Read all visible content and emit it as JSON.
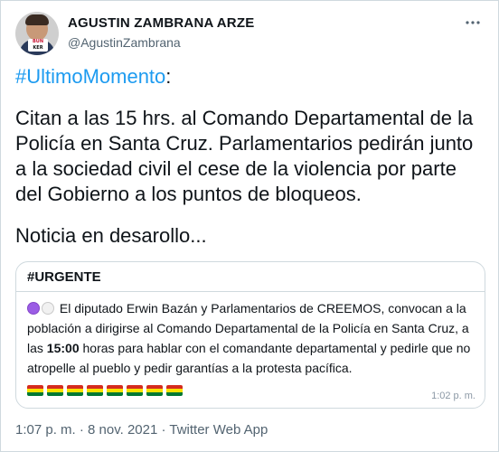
{
  "author": {
    "display_name": "AGUSTIN ZAMBRANA ARZE",
    "handle": "@AgustinZambrana",
    "avatar_logo_line1": "BUN",
    "avatar_logo_line2": "KER"
  },
  "more_icon": "more-horizontal-icon",
  "tweet": {
    "hashtag": "#UltimoMomento",
    "hashtag_suffix": ":",
    "paragraph": "Citan a las 15 hrs. al Comando Departamental de la Policía en Santa Cruz. Parlamentarios pedirán junto a la sociedad civil el cese de la violencia por parte del Gobierno a los puntos de bloqueos.",
    "closing": "Noticia en desarollo..."
  },
  "quote": {
    "title": "#URGENTE",
    "text_before": "El diputado Erwin Bazán y Parlamentarios de CREEMOS, convocan a la población a dirigirse al Comando Departamental de la Policía en Santa Cruz, a las ",
    "bold_time": "15:00",
    "text_after": " horas para hablar con el comandante departamental y pedirle que no atropelle al pueblo y pedir garantías a la protesta pacífica.",
    "flag_count": 8,
    "time": "1:02 p. m."
  },
  "footer": {
    "text": "1:07 p. m. · 8 nov. 2021 · Twitter Web App"
  },
  "colors": {
    "link": "#1d9bf0",
    "muted": "#536471",
    "border": "#cfd9de"
  }
}
